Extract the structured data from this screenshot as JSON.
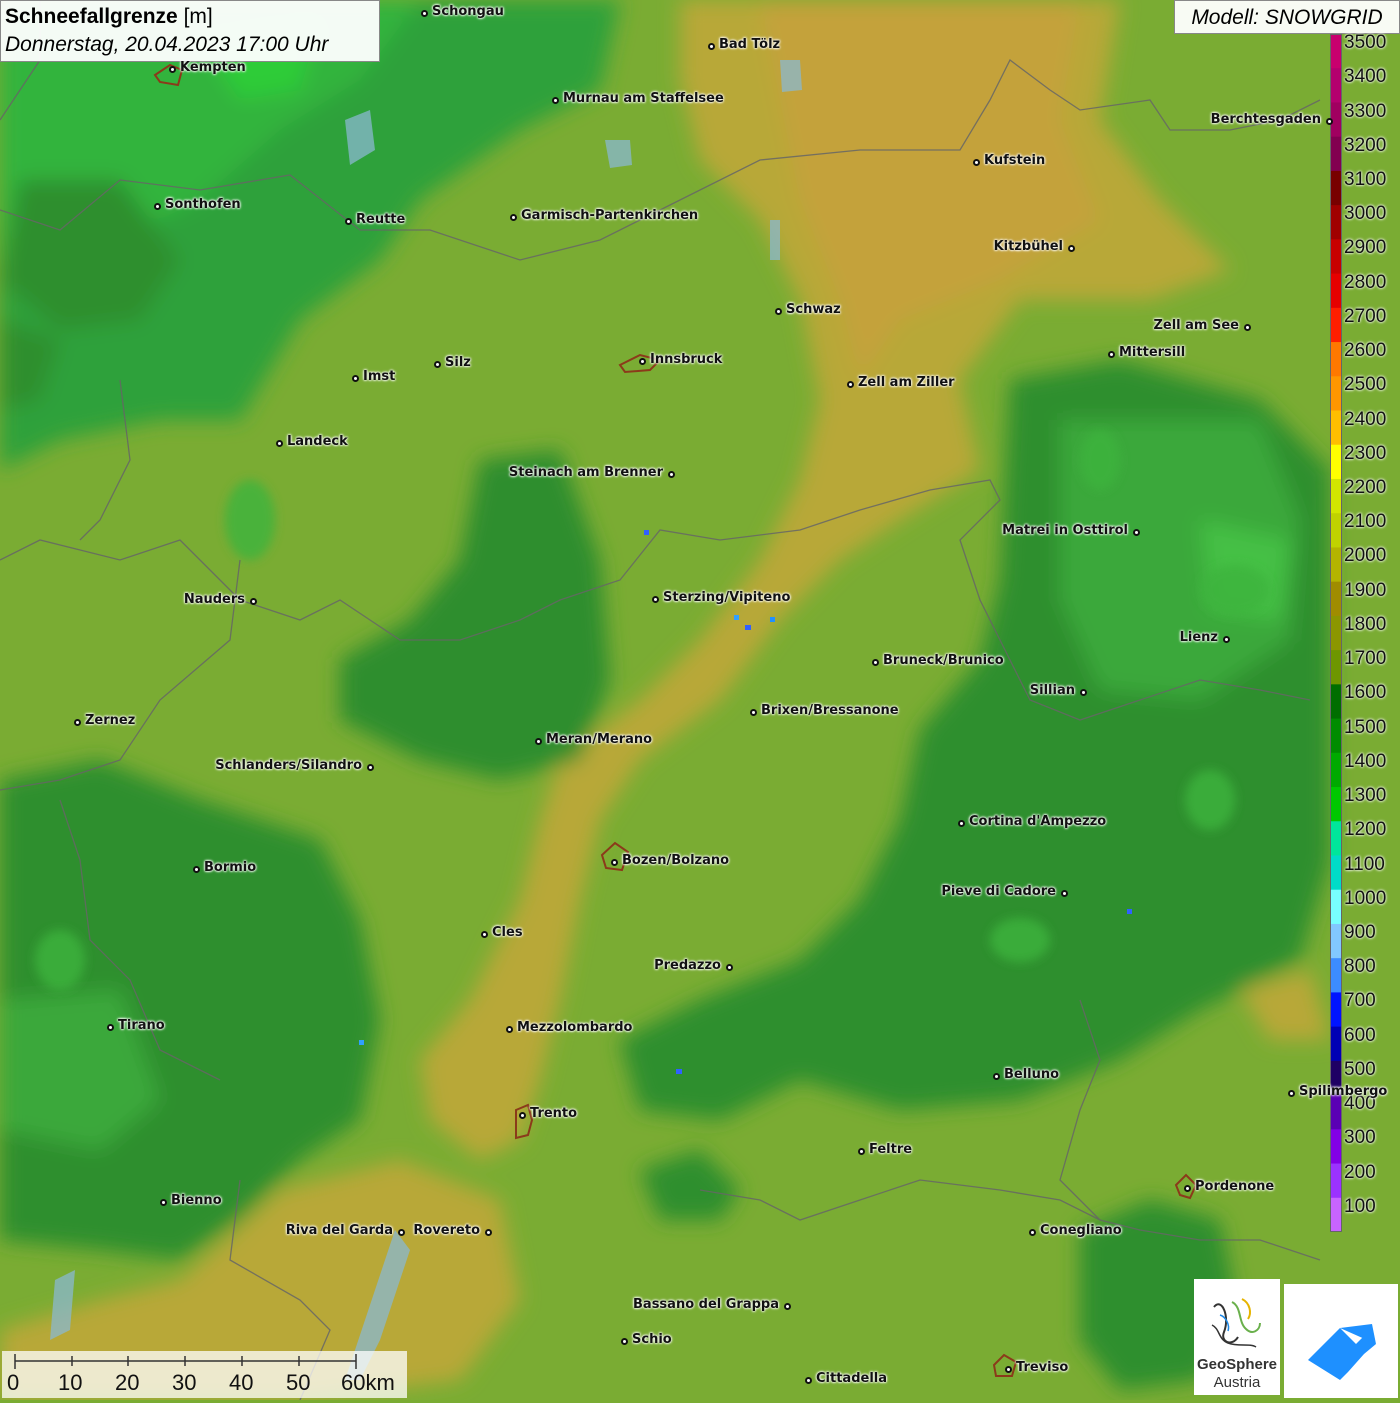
{
  "header": {
    "title_bold": "Schneefallgrenze",
    "title_unit": " [m]",
    "datetime": "Donnerstag, 20.04.2023 17:00 Uhr",
    "model": "Modell: SNOWGRID"
  },
  "legend": {
    "labels": [
      "3500",
      "3400",
      "3300",
      "3200",
      "3100",
      "3000",
      "2900",
      "2800",
      "2700",
      "2600",
      "2500",
      "2400",
      "2300",
      "2200",
      "2100",
      "2000",
      "1900",
      "1800",
      "1700",
      "1600",
      "1500",
      "1400",
      "1300",
      "1200",
      "1100",
      "1000",
      "900",
      "800",
      "700",
      "600",
      "500",
      "400",
      "300",
      "200",
      "100"
    ],
    "colors": [
      "#c8006e",
      "#b4006e",
      "#a00060",
      "#820050",
      "#780000",
      "#a00000",
      "#c80000",
      "#e60000",
      "#ff1e00",
      "#ff7800",
      "#ff9600",
      "#ffbe00",
      "#ffff00",
      "#d2e600",
      "#c0d200",
      "#b4b400",
      "#a08c00",
      "#8c9600",
      "#6e9600",
      "#006e00",
      "#008c00",
      "#00aa00",
      "#00c800",
      "#00e69b",
      "#00dcc8",
      "#78ffff",
      "#82c8ff",
      "#3c8cff",
      "#0014ff",
      "#0000b4",
      "#1e0064",
      "#5a00b4",
      "#8200e6",
      "#9b32ff",
      "#c864ff"
    ]
  },
  "cities": [
    {
      "name": "Schongau"
    },
    {
      "name": "Kempten"
    },
    {
      "name": "Bad Tölz"
    },
    {
      "name": "Murnau am Staffelsee"
    },
    {
      "name": "Kufstein"
    },
    {
      "name": "Berchtesgaden"
    },
    {
      "name": "Sonthofen"
    },
    {
      "name": "Reutte"
    },
    {
      "name": "Garmisch-Partenkirchen"
    },
    {
      "name": "Kitzbühel"
    },
    {
      "name": "Schwaz"
    },
    {
      "name": "Zell am See"
    },
    {
      "name": "Innsbruck"
    },
    {
      "name": "Mittersill"
    },
    {
      "name": "Imst"
    },
    {
      "name": "Silz"
    },
    {
      "name": "Zell am Ziller"
    },
    {
      "name": "Landeck"
    },
    {
      "name": "Steinach am Brenner"
    },
    {
      "name": "Matrei in Osttirol"
    },
    {
      "name": "Nauders"
    },
    {
      "name": "Sterzing/Vipiteno"
    },
    {
      "name": "Lienz"
    },
    {
      "name": "Bruneck/Brunico"
    },
    {
      "name": "Sillian"
    },
    {
      "name": "Zernez"
    },
    {
      "name": "Brixen/Bressanone"
    },
    {
      "name": "Meran/Merano"
    },
    {
      "name": "Schlanders/Silandro"
    },
    {
      "name": "Cortina d'Ampezzo"
    },
    {
      "name": "Bozen/Bolzano"
    },
    {
      "name": "Bormio"
    },
    {
      "name": "Pieve di Cadore"
    },
    {
      "name": "Cles"
    },
    {
      "name": "Predazzo"
    },
    {
      "name": "Tirano"
    },
    {
      "name": "Mezzolombardo"
    },
    {
      "name": "Belluno"
    },
    {
      "name": "Spilimbergo"
    },
    {
      "name": "Trento"
    },
    {
      "name": "Feltre"
    },
    {
      "name": "Pordenone"
    },
    {
      "name": "Bienno"
    },
    {
      "name": "Riva del Garda"
    },
    {
      "name": "Rovereto"
    },
    {
      "name": "Conegliano"
    },
    {
      "name": "Bassano del Grappa"
    },
    {
      "name": "Schio"
    },
    {
      "name": "Treviso"
    },
    {
      "name": "Cittadella"
    }
  ],
  "scale": {
    "labels": [
      "0",
      "10",
      "20",
      "30",
      "40",
      "50",
      "60km"
    ]
  },
  "logos": {
    "geosphere_line1": "GeoSphere",
    "geosphere_line2": "Austria"
  }
}
